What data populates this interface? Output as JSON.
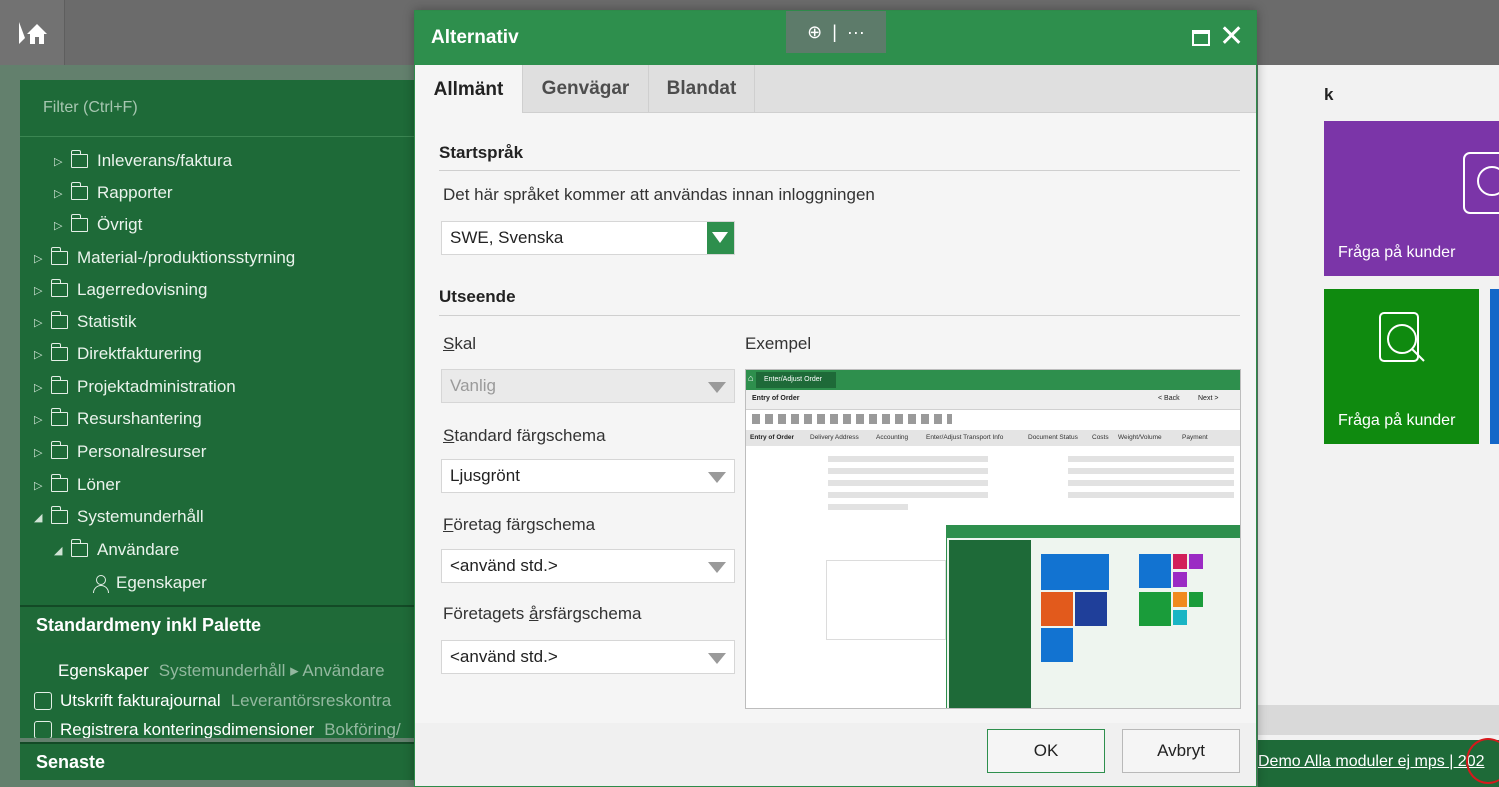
{
  "left_nav": {
    "filter_placeholder": "Filter (Ctrl+F)",
    "tree": [
      {
        "label": "Inleverans/faktura"
      },
      {
        "label": "Rapporter"
      },
      {
        "label": "Övrigt"
      },
      {
        "label": "Material-/produktionsstyrning"
      },
      {
        "label": "Lagerredovisning"
      },
      {
        "label": "Statistik"
      },
      {
        "label": "Direktfakturering"
      },
      {
        "label": "Projektadministration"
      },
      {
        "label": "Resurshantering"
      },
      {
        "label": "Personalresurser"
      },
      {
        "label": "Löner"
      },
      {
        "label": "Systemunderhåll"
      },
      {
        "label": "Användare"
      },
      {
        "label": "Egenskaper"
      }
    ],
    "menu_title": "Standardmeny inkl Palette",
    "recent": [
      {
        "name": "Egenskaper",
        "path": "Systemunderhåll ▸ Användare"
      },
      {
        "name": "Utskrift fakturajournal",
        "path": "Leverantörsreskontra"
      },
      {
        "name": "Registrera konteringsdimensioner",
        "path": "Bokföring/"
      }
    ],
    "recent_title": "Senaste"
  },
  "right_panel": {
    "header": "k",
    "tiles": [
      {
        "label": "Fråga på kunder",
        "color": "#7b35a8"
      },
      {
        "label": "Fråga på kunder",
        "color": "#0f8a0f"
      }
    ],
    "status_text": "Demo Alla moduler ej mps | 202"
  },
  "dialog": {
    "title": "Alternativ",
    "zoom_glyph": "⊕",
    "sep": "|",
    "more": "···",
    "tabs": [
      "Allmänt",
      "Genvägar",
      "Blandat"
    ],
    "start_lang": {
      "title": "Startspråk",
      "desc": "Det här språket kommer att användas innan inloggningen",
      "value": "SWE, Svenska"
    },
    "appearance": {
      "title": "Utseende",
      "shell_label_u": "S",
      "shell_label_rest": "kal",
      "shell_value": "Vanlig",
      "color_label_u": "S",
      "color_label_rest": "tandard färgschema",
      "color_value": "Ljusgrönt",
      "company_label_u": "F",
      "company_label_rest": "öretag färgschema",
      "company_value": "<använd std.>",
      "year_label_pre": "Företagets ",
      "year_label_u": "å",
      "year_label_rest": "rsfärgschema",
      "year_value": "<använd std.>",
      "example_label": "Exempel"
    },
    "preview": {
      "window_title": "Enter/Adjust Order",
      "header": "Entry of Order",
      "nav_back": "< Back",
      "nav_next": "Next >",
      "tabs": [
        "Entry of Order",
        "Delivery Address",
        "Accounting",
        "Enter/Adjust Transport Info",
        "Document Status",
        "Costs",
        "Weight/Volume",
        "Payment"
      ]
    },
    "ok": "OK",
    "cancel": "Avbryt"
  }
}
